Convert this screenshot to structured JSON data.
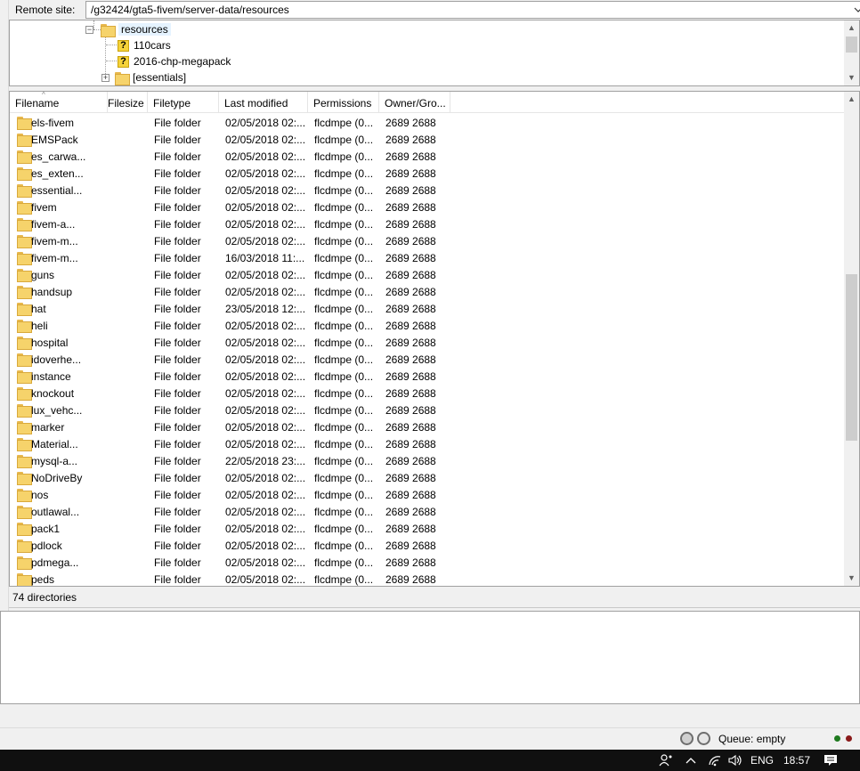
{
  "remote": {
    "label": "Remote site:",
    "path": "/g32424/gta5-fivem/server-data/resources"
  },
  "tree": {
    "items": [
      {
        "label": "resources",
        "icon": "folder-icon"
      },
      {
        "label": "110cars",
        "icon": "unknown-icon"
      },
      {
        "label": "2016-chp-megapack",
        "icon": "unknown-icon"
      },
      {
        "label": "[essentials]",
        "icon": "folder-icon"
      }
    ]
  },
  "columns": [
    "Filename",
    "Filesize",
    "Filetype",
    "Last modified",
    "Permissions",
    "Owner/Gro..."
  ],
  "files": [
    [
      "els-fivem",
      "",
      "File folder",
      "02/05/2018 02:...",
      "flcdmpe (0...",
      "2689 2688"
    ],
    [
      "EMSPack",
      "",
      "File folder",
      "02/05/2018 02:...",
      "flcdmpe (0...",
      "2689 2688"
    ],
    [
      "es_carwa...",
      "",
      "File folder",
      "02/05/2018 02:...",
      "flcdmpe (0...",
      "2689 2688"
    ],
    [
      "es_exten...",
      "",
      "File folder",
      "02/05/2018 02:...",
      "flcdmpe (0...",
      "2689 2688"
    ],
    [
      "essential...",
      "",
      "File folder",
      "02/05/2018 02:...",
      "flcdmpe (0...",
      "2689 2688"
    ],
    [
      "fivem",
      "",
      "File folder",
      "02/05/2018 02:...",
      "flcdmpe (0...",
      "2689 2688"
    ],
    [
      "fivem-a...",
      "",
      "File folder",
      "02/05/2018 02:...",
      "flcdmpe (0...",
      "2689 2688"
    ],
    [
      "fivem-m...",
      "",
      "File folder",
      "02/05/2018 02:...",
      "flcdmpe (0...",
      "2689 2688"
    ],
    [
      "fivem-m...",
      "",
      "File folder",
      "16/03/2018 11:...",
      "flcdmpe (0...",
      "2689 2688"
    ],
    [
      "guns",
      "",
      "File folder",
      "02/05/2018 02:...",
      "flcdmpe (0...",
      "2689 2688"
    ],
    [
      "handsup",
      "",
      "File folder",
      "02/05/2018 02:...",
      "flcdmpe (0...",
      "2689 2688"
    ],
    [
      "hat",
      "",
      "File folder",
      "23/05/2018 12:...",
      "flcdmpe (0...",
      "2689 2688"
    ],
    [
      "heli",
      "",
      "File folder",
      "02/05/2018 02:...",
      "flcdmpe (0...",
      "2689 2688"
    ],
    [
      "hospital",
      "",
      "File folder",
      "02/05/2018 02:...",
      "flcdmpe (0...",
      "2689 2688"
    ],
    [
      "idoverhe...",
      "",
      "File folder",
      "02/05/2018 02:...",
      "flcdmpe (0...",
      "2689 2688"
    ],
    [
      "instance",
      "",
      "File folder",
      "02/05/2018 02:...",
      "flcdmpe (0...",
      "2689 2688"
    ],
    [
      "knockout",
      "",
      "File folder",
      "02/05/2018 02:...",
      "flcdmpe (0...",
      "2689 2688"
    ],
    [
      "lux_vehc...",
      "",
      "File folder",
      "02/05/2018 02:...",
      "flcdmpe (0...",
      "2689 2688"
    ],
    [
      "marker",
      "",
      "File folder",
      "02/05/2018 02:...",
      "flcdmpe (0...",
      "2689 2688"
    ],
    [
      "Material...",
      "",
      "File folder",
      "02/05/2018 02:...",
      "flcdmpe (0...",
      "2689 2688"
    ],
    [
      "mysql-a...",
      "",
      "File folder",
      "22/05/2018 23:...",
      "flcdmpe (0...",
      "2689 2688"
    ],
    [
      "NoDriveBy",
      "",
      "File folder",
      "02/05/2018 02:...",
      "flcdmpe (0...",
      "2689 2688"
    ],
    [
      "nos",
      "",
      "File folder",
      "02/05/2018 02:...",
      "flcdmpe (0...",
      "2689 2688"
    ],
    [
      "outlawal...",
      "",
      "File folder",
      "02/05/2018 02:...",
      "flcdmpe (0...",
      "2689 2688"
    ],
    [
      "pack1",
      "",
      "File folder",
      "02/05/2018 02:...",
      "flcdmpe (0...",
      "2689 2688"
    ],
    [
      "pdlock",
      "",
      "File folder",
      "02/05/2018 02:...",
      "flcdmpe (0...",
      "2689 2688"
    ],
    [
      "pdmega...",
      "",
      "File folder",
      "02/05/2018 02:...",
      "flcdmpe (0...",
      "2689 2688"
    ],
    [
      "peds",
      "",
      "File folder",
      "02/05/2018 02:...",
      "flcdmpe (0...",
      "2689 2688"
    ]
  ],
  "status": {
    "directories": "74 directories"
  },
  "queue": {
    "label": "Queue: empty"
  },
  "taskbar": {
    "language": "ENG",
    "time": "18:57"
  }
}
